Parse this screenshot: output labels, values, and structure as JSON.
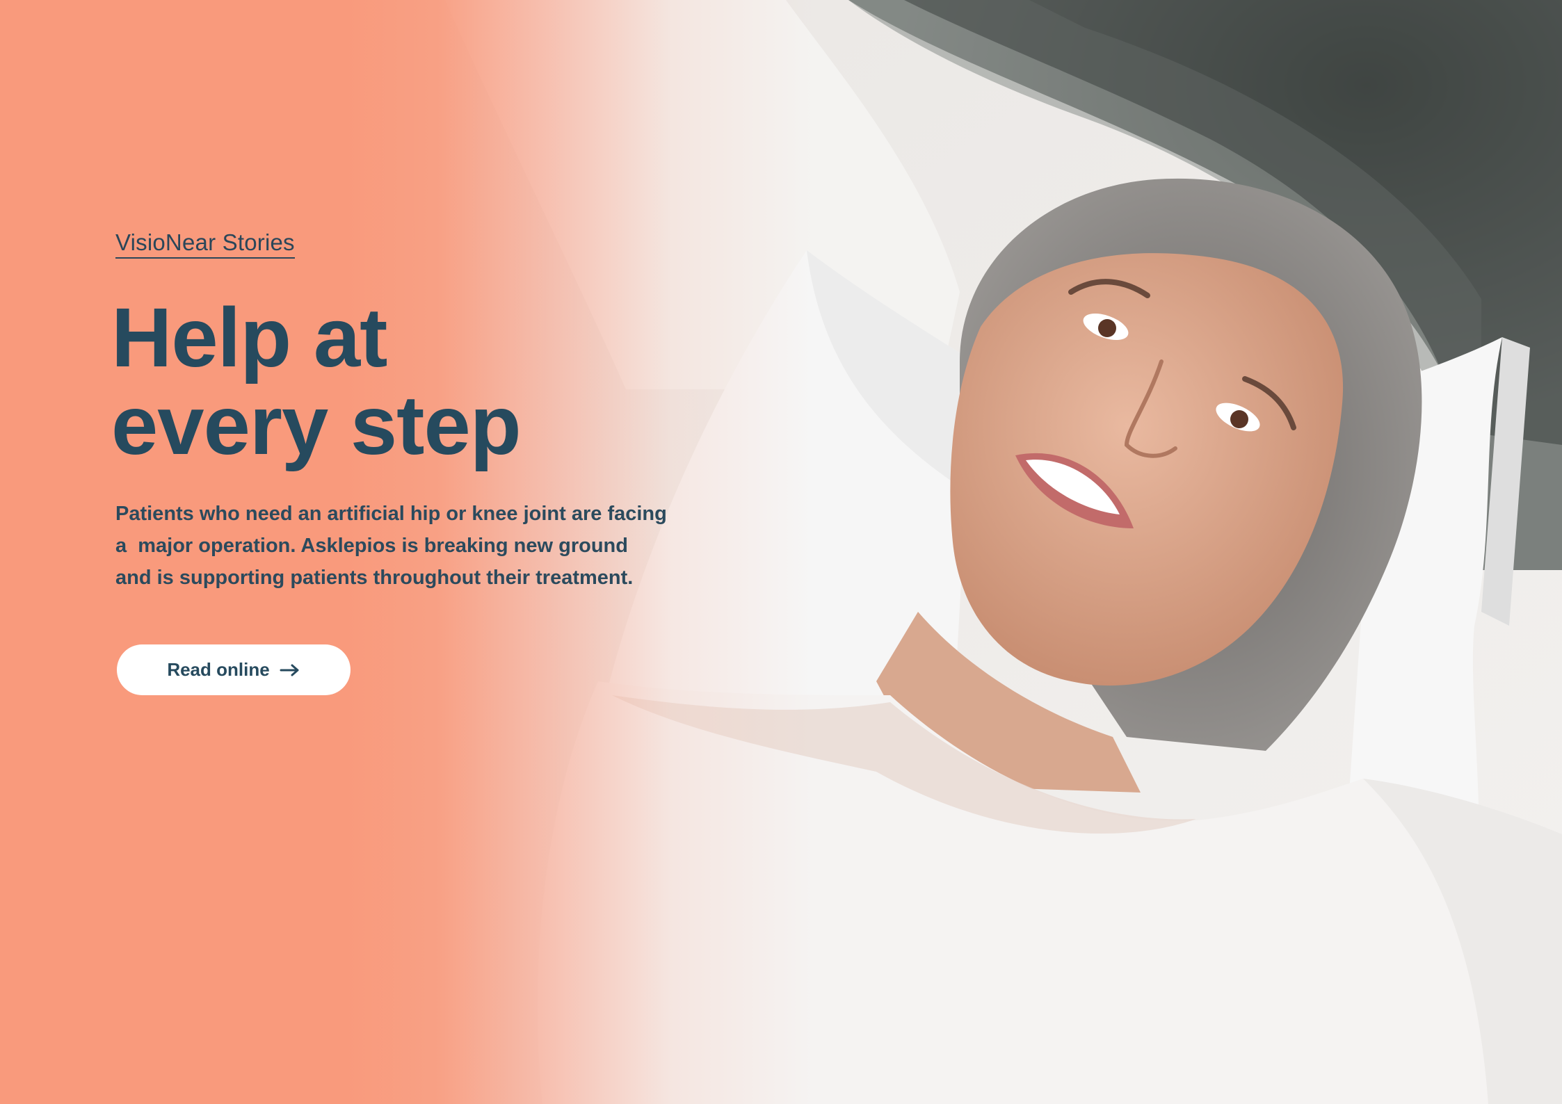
{
  "hero": {
    "eyebrow": "VisioNear Stories",
    "headline_line1": "Help at",
    "headline_line2": "every step",
    "body_lines": [
      "Patients who need an artificial hip or knee joint are facing",
      "a  major operation. Asklepios is breaking new ground",
      "and is supporting patients throughout their treatment."
    ],
    "cta_label": "Read online",
    "cta_icon": "arrow-right-icon"
  },
  "colors": {
    "accent_coral": "#f99a7c",
    "text_navy": "#264a5e",
    "button_bg": "#ffffff"
  },
  "image": {
    "subject": "smiling woman with grey hair lying on a pillow in an MRI scanner"
  }
}
